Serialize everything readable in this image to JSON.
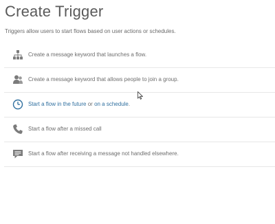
{
  "page": {
    "title": "Create Trigger",
    "subtitle": "Triggers allow users to start flows based on user actions or schedules."
  },
  "triggers": [
    {
      "icon": "org-chart-icon",
      "label": "Create a message keyword that launches a flow."
    },
    {
      "icon": "group-users-icon",
      "label": "Create a message keyword that allows people to join a group."
    },
    {
      "icon": "clock-icon",
      "label_link1": "Start a flow in the future",
      "label_mid": " or ",
      "label_link2": "on a schedule",
      "label_end": "."
    },
    {
      "icon": "phone-icon",
      "label": "Start a flow after a missed call"
    },
    {
      "icon": "chat-bubble-icon",
      "label": "Start a flow after receiving a message not handled elsewhere."
    }
  ],
  "colors": {
    "link": "#2f6f9f",
    "icon": "#7b7b7b",
    "divider": "#e7e7e7"
  }
}
